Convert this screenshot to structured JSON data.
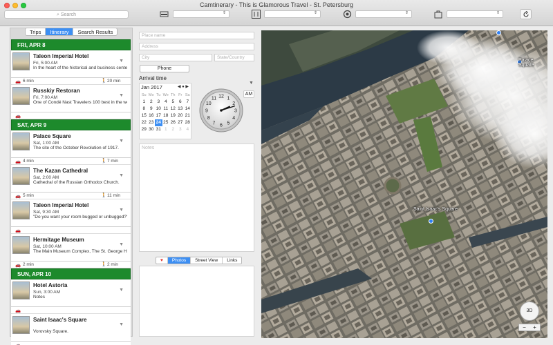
{
  "app": {
    "title": "Camtinerary - This is Glamorous Travel - St. Petersburg"
  },
  "toolbar": {
    "search_placeholder": "Search",
    "icons": [
      "hotel-icon",
      "restaurant-icon",
      "attraction-icon",
      "shopping-icon",
      "refresh-icon"
    ]
  },
  "tabs": {
    "trips": "Trips",
    "itinerary": "Itinerary",
    "search_results": "Search Results",
    "selected": "Itinerary"
  },
  "days": [
    {
      "label": "FRI, APR 8",
      "items": [
        {
          "name": "Taleon Imperial Hotel",
          "time": "Fri, 5:00 AM",
          "desc": "In the heart of the historical and business center...",
          "drive": "6 min",
          "walk": "20 min"
        },
        {
          "name": "Russkiy Restoran",
          "time": "Fri, 7:00 AM",
          "desc": "One of Condé Nast Travelers 100 best in the worl...",
          "drive": "",
          "walk": ""
        }
      ]
    },
    {
      "label": "SAT, APR 9",
      "items": [
        {
          "name": "Palace Square",
          "time": "Sat, 1:00 AM",
          "desc": "The site of the October Revolution of 1917.",
          "drive": "4 min",
          "walk": "7 min"
        },
        {
          "name": "The Kazan Cathedral",
          "time": "Sat, 2:00 AM",
          "desc": "Cathedral of the Russian Orthodox Church.",
          "drive": "5 min",
          "walk": "11 min"
        },
        {
          "name": "Taleon Imperial Hotel",
          "time": "Sat, 9:30 AM",
          "desc": "\"Do you want your room bugged or unbugged?\"",
          "drive": "",
          "walk": ""
        },
        {
          "name": "Hermitage Museum",
          "time": "Sat, 10:00 AM",
          "desc": "The Main Museum Complex, The St. George Hall, The R...",
          "drive": "2 min",
          "walk": "2 min"
        }
      ]
    },
    {
      "label": "SUN, APR 10",
      "items": [
        {
          "name": "Hotel Astoria",
          "time": "Sun, 3:00 AM",
          "desc": "Notes",
          "drive": "",
          "walk": ""
        },
        {
          "name": "Saint Isaac's Square",
          "time": "",
          "desc": "Vorovsky Square.",
          "drive": "",
          "walk": ""
        }
      ]
    }
  ],
  "form": {
    "place_name": "Place name",
    "address": "Address",
    "city": "City",
    "state_country": "State/Country",
    "phone_button": "Phone",
    "arrival_label": "Arrival time",
    "ampm": "AM",
    "notes_placeholder": "Notes"
  },
  "calendar": {
    "month": "Jan 2017",
    "weekdays": [
      "Su",
      "Mo",
      "Tu",
      "We",
      "Th",
      "Fr",
      "Sa"
    ],
    "weeks": [
      [
        "1",
        "2",
        "3",
        "4",
        "5",
        "6",
        "7"
      ],
      [
        "8",
        "9",
        "10",
        "11",
        "12",
        "13",
        "14"
      ],
      [
        "15",
        "16",
        "17",
        "18",
        "19",
        "20",
        "21"
      ],
      [
        "22",
        "23",
        "24",
        "25",
        "26",
        "27",
        "28"
      ],
      [
        "29",
        "30",
        "31",
        "1",
        "2",
        "3",
        "4"
      ]
    ],
    "selected": "24"
  },
  "clock": {
    "hour": 2,
    "minute": 12
  },
  "media_tabs": {
    "favorite": "♥",
    "photos": "Photos",
    "street_view": "Street View",
    "links": "Links",
    "selected": "Photos"
  },
  "map": {
    "labels": {
      "palace_square": "Palace Square",
      "saint_isaacs": "Saint Isaac's Square"
    },
    "compass_label": "3D",
    "zoom_out": "−",
    "zoom_in": "+"
  }
}
